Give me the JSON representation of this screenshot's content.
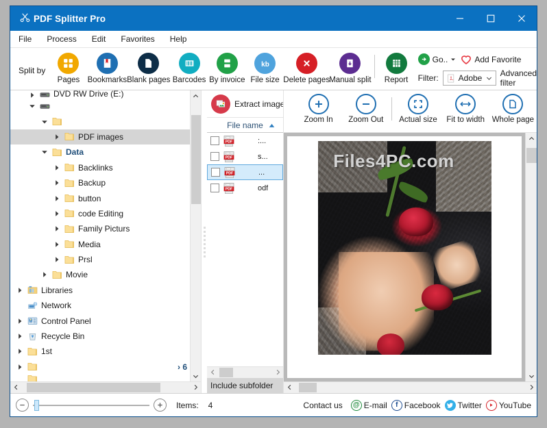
{
  "window": {
    "title": "PDF Splitter Pro",
    "app_icon": "scissors-icon",
    "minimize": "minimize-icon",
    "maximize": "maximize-icon",
    "close": "close-icon"
  },
  "menu": {
    "items": [
      {
        "label": "File"
      },
      {
        "label": "Process"
      },
      {
        "label": "Edit"
      },
      {
        "label": "Favorites"
      },
      {
        "label": "Help"
      }
    ]
  },
  "toolbar": {
    "split_by_label": "Split by",
    "buttons": [
      {
        "label": "Pages",
        "icon": "grid-icon",
        "color": "#f1a800"
      },
      {
        "label": "Bookmarks",
        "icon": "bookmark-icon",
        "color": "#1f6fb2"
      },
      {
        "label": "Blank pages",
        "icon": "blank-page-icon",
        "color": "#0d2d47"
      },
      {
        "label": "Barcodes",
        "icon": "barcode-icon",
        "color": "#11adc1"
      },
      {
        "label": "By invoice",
        "icon": "invoice-split-icon",
        "color": "#21a148"
      },
      {
        "label": "File size",
        "icon": "kb-icon",
        "color": "#4fa3dd"
      },
      {
        "label": "Delete pages",
        "icon": "delete-x-icon",
        "color": "#d61f26"
      },
      {
        "label": "Manual split",
        "icon": "manual-split-icon",
        "color": "#5c2d91"
      }
    ],
    "report": {
      "label": "Report",
      "icon": "report-grid-icon",
      "color": "#127a3e"
    },
    "go": {
      "label": "Go..",
      "icon": "go-arrow-icon",
      "color": "#21a148"
    },
    "add_favorite": {
      "label": "Add Favorite",
      "icon": "heart-icon",
      "color": "#e8414a"
    },
    "filter_label": "Filter:",
    "filter_value": "Adobe",
    "filter_icon": "adobe-pdf-icon",
    "filter_chevron": "chevron-down-icon",
    "advanced_filter": "Advanced filter"
  },
  "tree": {
    "items": [
      {
        "label": "DVD RW Drive (E:)",
        "icon": "drive-icon",
        "indent": 1,
        "twisty": "right",
        "clipped": true
      },
      {
        "label": "",
        "icon": "drive-icon",
        "indent": 1,
        "twisty": "down"
      },
      {
        "label": "",
        "icon": "folder-icon",
        "indent": 2,
        "twisty": "down"
      },
      {
        "label": "PDF images",
        "icon": "folder-icon",
        "indent": 3,
        "twisty": "right",
        "selected": true
      },
      {
        "label": "Data",
        "icon": "folder-icon",
        "indent": 2,
        "twisty": "down",
        "bold": true
      },
      {
        "label": "Backlinks",
        "icon": "folder-icon",
        "indent": 3,
        "twisty": "right"
      },
      {
        "label": "Backup",
        "icon": "folder-icon",
        "indent": 3,
        "twisty": "right"
      },
      {
        "label": "button",
        "icon": "folder-icon",
        "indent": 3,
        "twisty": "right"
      },
      {
        "label": "code Editing",
        "icon": "folder-icon",
        "indent": 3,
        "twisty": "right"
      },
      {
        "label": "Family Picturs",
        "icon": "folder-icon",
        "indent": 3,
        "twisty": "right"
      },
      {
        "label": "Media",
        "icon": "folder-icon",
        "indent": 3,
        "twisty": "right"
      },
      {
        "label": "Prsl",
        "icon": "folder-icon",
        "indent": 3,
        "twisty": "right"
      },
      {
        "label": "Movie",
        "icon": "folder-icon",
        "indent": 2,
        "twisty": "right"
      },
      {
        "label": "Libraries",
        "icon": "libraries-icon",
        "indent": 0,
        "twisty": "right"
      },
      {
        "label": "Network",
        "icon": "network-icon",
        "indent": 0,
        "twisty": "none"
      },
      {
        "label": "Control Panel",
        "icon": "control-panel-icon",
        "indent": 0,
        "twisty": "right"
      },
      {
        "label": "Recycle Bin",
        "icon": "recycle-bin-icon",
        "indent": 0,
        "twisty": "right"
      },
      {
        "label": "1st",
        "icon": "folder-icon",
        "indent": 0,
        "twisty": "right"
      },
      {
        "label": "",
        "icon": "folder-icon",
        "indent": 0,
        "twisty": "right",
        "badge": "6"
      },
      {
        "label": "",
        "icon": "folder-icon",
        "indent": 0,
        "twisty": "none",
        "clipped": true
      }
    ],
    "badge_text": "6",
    "scroll_up": "chevron-up-icon",
    "scroll_down": "chevron-down-icon",
    "scroll_left": "chevron-left-icon",
    "scroll_right": "chevron-right-icon"
  },
  "file_list": {
    "extract_label": "Extract image",
    "extract_icon": "extract-image-icon",
    "column_header": "File name",
    "sort_direction": "ascending",
    "sort_icon": "sort-asc-icon",
    "rows": [
      {
        "name": ":...",
        "icon": "pdf-file-icon",
        "checked": false,
        "selected": false
      },
      {
        "name": "s...",
        "icon": "pdf-file-icon",
        "checked": false,
        "selected": false
      },
      {
        "name": "...",
        "icon": "pdf-file-icon",
        "checked": false,
        "selected": true
      },
      {
        "name": "odf",
        "icon": "pdf-file-icon",
        "checked": false,
        "selected": false
      }
    ],
    "include_subfolder": "Include subfolder",
    "scroll_left": "chevron-left-icon",
    "scroll_right": "chevron-right-icon"
  },
  "preview": {
    "buttons": [
      {
        "label": "Zoom In",
        "icon": "zoom-in-icon"
      },
      {
        "label": "Zoom Out",
        "icon": "zoom-out-icon"
      },
      {
        "label": "Actual size",
        "icon": "actual-size-icon"
      },
      {
        "label": "Fit to width",
        "icon": "fit-width-icon"
      },
      {
        "label": "Whole page",
        "icon": "whole-page-icon"
      }
    ],
    "watermark": "Files4PC.com",
    "scroll_up": "chevron-up-icon",
    "scroll_down": "chevron-down-icon",
    "scroll_left": "chevron-left-icon",
    "scroll_right": "chevron-right-icon"
  },
  "status": {
    "zoom_out_icon": "minus-circle-icon",
    "zoom_in_icon": "plus-circle-icon",
    "slider_value": 0,
    "items_label": "Items:",
    "items_count": "4",
    "contact_label": "Contact us",
    "links": [
      {
        "label": "E-mail",
        "icon": "email-at-icon",
        "color": "#1f8a3b"
      },
      {
        "label": "Facebook",
        "icon": "facebook-icon",
        "color": "#1a4a8f"
      },
      {
        "label": "Twitter",
        "icon": "twitter-icon",
        "color": "#33b0e8"
      },
      {
        "label": "YouTube",
        "icon": "youtube-icon",
        "color": "#d61f26"
      }
    ]
  },
  "colors": {
    "titlebar": "#0b71c1",
    "accent": "#1f6fb2",
    "selection": "#d4ebfb",
    "tree_selection": "#d5d5d5"
  }
}
